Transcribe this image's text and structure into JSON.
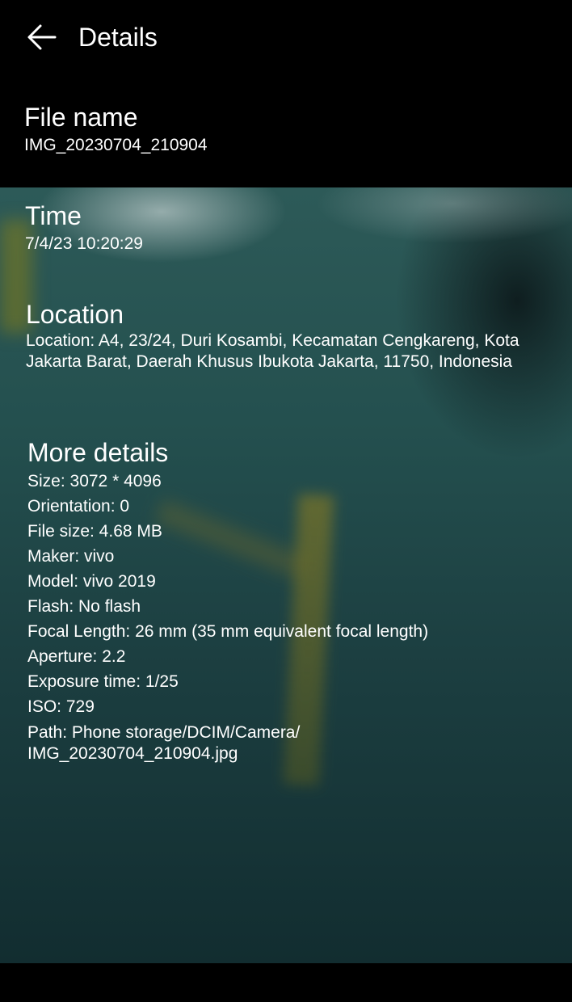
{
  "header": {
    "back_icon": "arrow-left-icon",
    "title": "Details"
  },
  "file": {
    "label": "File name",
    "value": "IMG_20230704_210904"
  },
  "time": {
    "label": "Time",
    "value": "7/4/23 10:20:29"
  },
  "location": {
    "label": "Location",
    "value": "Location: A4, 23/24, Duri Kosambi, Kecamatan Cengkareng, Kota Jakarta Barat, Daerah Khusus Ibukota Jakarta, 11750, Indonesia"
  },
  "more": {
    "label": "More details",
    "rows": [
      "Size: 3072 * 4096",
      "Orientation: 0",
      "File size: 4.68 MB",
      "Maker: vivo",
      "Model: vivo 2019",
      "Flash: No flash",
      "Focal Length: 26 mm (35 mm equivalent focal length)",
      "Aperture: 2.2",
      "Exposure time: 1/25",
      "ISO: 729"
    ],
    "path": "Path: Phone storage/DCIM/Camera/\nIMG_20230704_210904.jpg"
  }
}
